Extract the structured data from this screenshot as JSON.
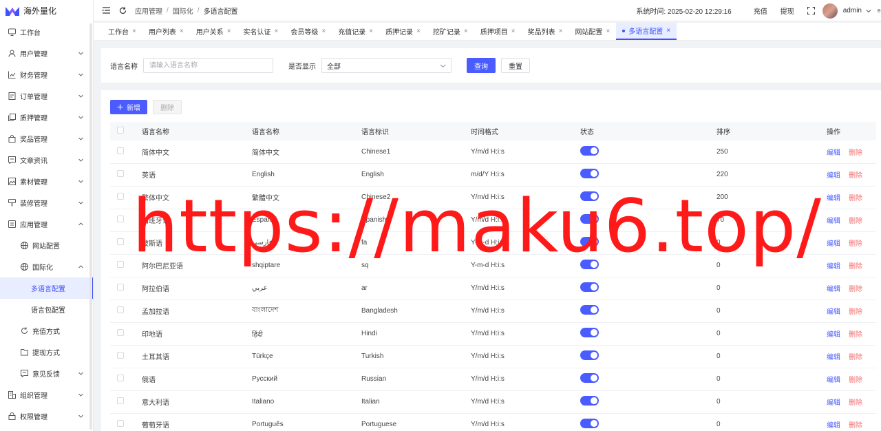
{
  "app": {
    "title": "海外量化"
  },
  "sidebar": {
    "items": [
      {
        "label": "工作台",
        "icon": "monitor-icon",
        "level": 0,
        "expandable": false
      },
      {
        "label": "用户管理",
        "icon": "user-icon",
        "level": 0,
        "expandable": true
      },
      {
        "label": "财务管理",
        "icon": "chart-icon",
        "level": 0,
        "expandable": true
      },
      {
        "label": "订单管理",
        "icon": "order-icon",
        "level": 0,
        "expandable": true
      },
      {
        "label": "质押管理",
        "icon": "copy-icon",
        "level": 0,
        "expandable": true
      },
      {
        "label": "奖品管理",
        "icon": "bag-icon",
        "level": 0,
        "expandable": true
      },
      {
        "label": "文章资讯",
        "icon": "message-icon",
        "level": 0,
        "expandable": true
      },
      {
        "label": "素材管理",
        "icon": "image-icon",
        "level": 0,
        "expandable": true
      },
      {
        "label": "装修管理",
        "icon": "brush-icon",
        "level": 0,
        "expandable": true
      },
      {
        "label": "应用管理",
        "icon": "app-icon",
        "level": 0,
        "expandable": true,
        "open": true
      },
      {
        "label": "网站配置",
        "icon": "globe-icon",
        "level": 1,
        "expandable": false
      },
      {
        "label": "国际化",
        "icon": "globe-icon",
        "level": 1,
        "expandable": true,
        "open": true
      },
      {
        "label": "多语言配置",
        "icon": "",
        "level": 2,
        "expandable": false,
        "active": true
      },
      {
        "label": "语言包配置",
        "icon": "",
        "level": 2,
        "expandable": false
      },
      {
        "label": "充值方式",
        "icon": "refresh-icon",
        "level": 1,
        "expandable": false
      },
      {
        "label": "提现方式",
        "icon": "folder-icon",
        "level": 1,
        "expandable": false
      },
      {
        "label": "意见反馈",
        "icon": "message-icon",
        "level": 1,
        "expandable": true
      },
      {
        "label": "组织管理",
        "icon": "building-icon",
        "level": 0,
        "expandable": true
      },
      {
        "label": "权限管理",
        "icon": "lock-icon",
        "level": 0,
        "expandable": true
      }
    ]
  },
  "header": {
    "breadcrumb": [
      "应用管理",
      "国际化",
      "多语言配置"
    ],
    "system_time": "系统时间: 2025-02-20 12:29:16",
    "recharge": "充值",
    "withdraw": "提现",
    "username": "admin"
  },
  "tabs": [
    {
      "label": "工作台"
    },
    {
      "label": "用户列表"
    },
    {
      "label": "用户关系"
    },
    {
      "label": "实名认证"
    },
    {
      "label": "会员等级"
    },
    {
      "label": "充值记录"
    },
    {
      "label": "质押记录"
    },
    {
      "label": "挖矿记录"
    },
    {
      "label": "质押项目"
    },
    {
      "label": "奖品列表"
    },
    {
      "label": "网站配置"
    },
    {
      "label": "多语言配置",
      "active": true
    }
  ],
  "search": {
    "name_label": "语言名称",
    "name_placeholder": "请输入语言名称",
    "display_label": "是否显示",
    "display_value": "全部",
    "query_button": "查询",
    "reset_button": "重置"
  },
  "toolbar": {
    "add_button": "新增",
    "delete_button": "删除"
  },
  "table": {
    "columns": [
      "语言名称",
      "语言名称",
      "语言标识",
      "时间格式",
      "状态",
      "排序",
      "操作"
    ],
    "edit_label": "编辑",
    "delete_label": "删除",
    "rows": [
      {
        "name": "简体中文",
        "native": "简体中文",
        "code": "Chinese1",
        "format": "Y/m/d H:i:s",
        "status": true,
        "sort": "250"
      },
      {
        "name": "英语",
        "native": "English",
        "code": "English",
        "format": "m/d/Y H:i:s",
        "status": true,
        "sort": "220"
      },
      {
        "name": "繁体中文",
        "native": "繁體中文",
        "code": "Chinese2",
        "format": "Y/m/d H:i:s",
        "status": true,
        "sort": "200"
      },
      {
        "name": "西班牙语",
        "native": "Español",
        "code": "Spanish",
        "format": "Y/m/d H:i:s",
        "status": true,
        "sort": "70"
      },
      {
        "name": "波斯语",
        "native": "فارسی",
        "code": "fa",
        "format": "Y-m-d H:i:s",
        "status": true,
        "sort": "0"
      },
      {
        "name": "阿尔巴尼亚语",
        "native": "shqiptare",
        "code": "sq",
        "format": "Y-m-d H:i:s",
        "status": true,
        "sort": "0"
      },
      {
        "name": "阿拉伯语",
        "native": "عربي",
        "code": "ar",
        "format": "Y/m/d H:i:s",
        "status": true,
        "sort": "0"
      },
      {
        "name": "孟加拉语",
        "native": "বাংলাদেশ",
        "code": "Bangladesh",
        "format": "Y/m/d H:i:s",
        "status": true,
        "sort": "0"
      },
      {
        "name": "印地语",
        "native": "हिंदी",
        "code": "Hindi",
        "format": "Y/m/d H:i:s",
        "status": true,
        "sort": "0"
      },
      {
        "name": "土耳其语",
        "native": "Türkçe",
        "code": "Turkish",
        "format": "Y/m/d H:i:s",
        "status": true,
        "sort": "0"
      },
      {
        "name": "俄语",
        "native": "Русский",
        "code": "Russian",
        "format": "Y/m/d H:i:s",
        "status": true,
        "sort": "0"
      },
      {
        "name": "意大利语",
        "native": "Italiano",
        "code": "Italian",
        "format": "Y/m/d H:i:s",
        "status": true,
        "sort": "0"
      },
      {
        "name": "葡萄牙语",
        "native": "Português",
        "code": "Portuguese",
        "format": "Y/m/d H:i:s",
        "status": true,
        "sort": "0"
      }
    ]
  },
  "watermark": {
    "text": "https://maku6.top/"
  },
  "colors": {
    "primary": "#4a5cff",
    "danger": "#f56c6c",
    "watermark": "#ff1a1a",
    "active_bg": "#e8edff"
  }
}
